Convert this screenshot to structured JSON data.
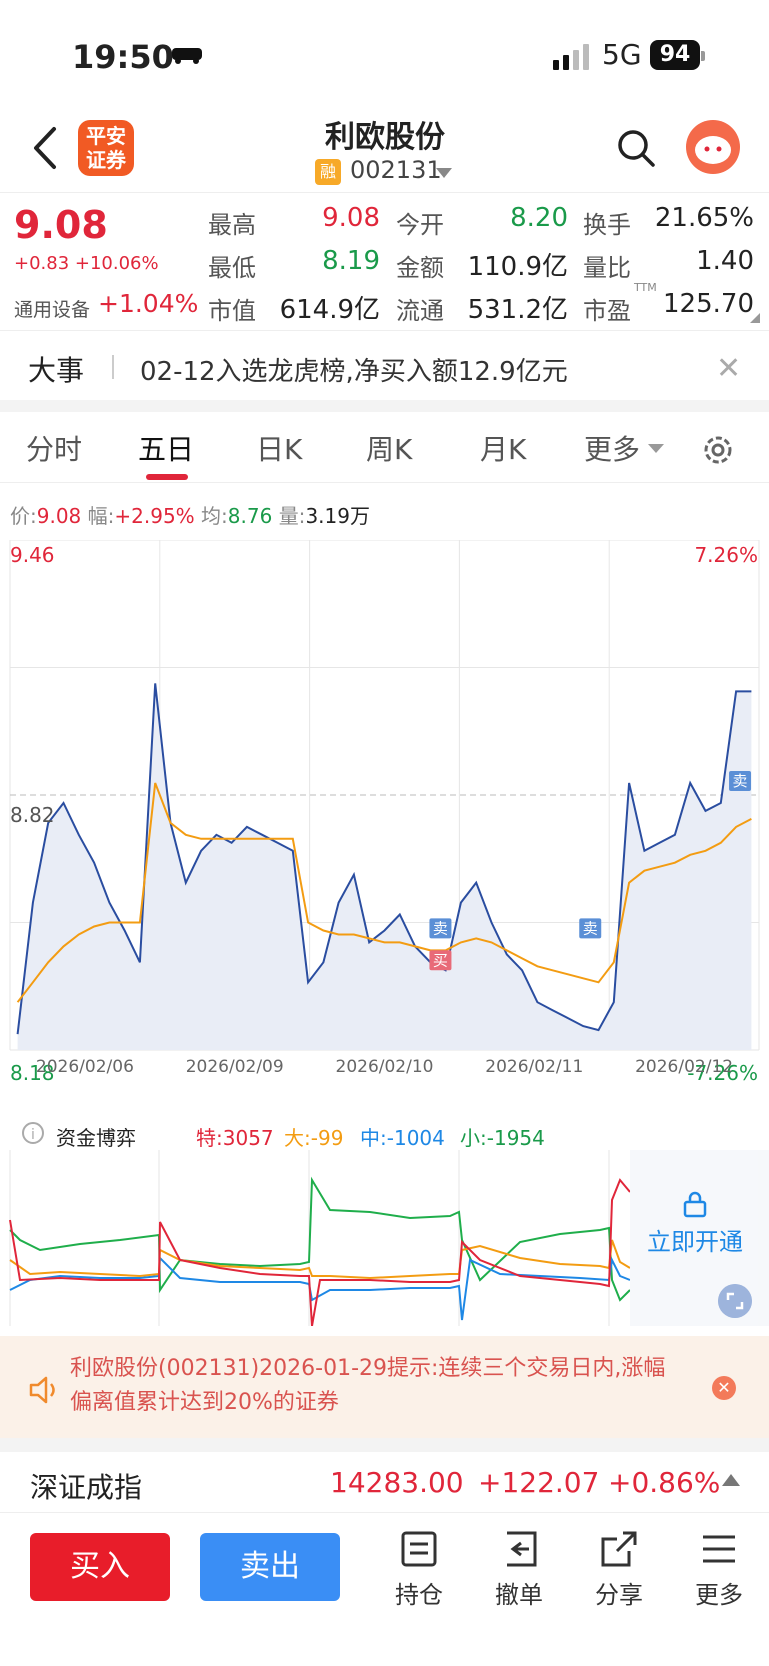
{
  "status": {
    "time": "19:50",
    "network": "5G",
    "battery": "94"
  },
  "header": {
    "logo_line1": "平安",
    "logo_line2": "证券",
    "stock_name": "利欧股份",
    "badge": "融",
    "stock_code": "002131"
  },
  "quote": {
    "price": "9.08",
    "change": "+0.83 +10.06%",
    "sector_name": "通用设备",
    "sector_pct": "+1.04%",
    "fields": [
      {
        "label": "最高",
        "value": "9.08",
        "color": "red"
      },
      {
        "label": "今开",
        "value": "8.20",
        "color": "green"
      },
      {
        "label": "换手",
        "value": "21.65%",
        "color": "black"
      },
      {
        "label": "最低",
        "value": "8.19",
        "color": "green"
      },
      {
        "label": "金额",
        "value": "110.9亿",
        "color": "black"
      },
      {
        "label": "量比",
        "value": "1.40",
        "color": "black"
      },
      {
        "label": "市值",
        "value": "614.9亿",
        "color": "black"
      },
      {
        "label": "流通",
        "value": "531.2亿",
        "color": "black"
      },
      {
        "label": "市盈",
        "value": "125.70",
        "color": "black"
      }
    ],
    "pe_suffix": "TTM"
  },
  "event": {
    "title": "大事",
    "text": "02-12入选龙虎榜,净买入额12.9亿元"
  },
  "tabs": [
    {
      "label": "分时",
      "active": false
    },
    {
      "label": "五日",
      "active": true
    },
    {
      "label": "日K",
      "active": false
    },
    {
      "label": "周K",
      "active": false
    },
    {
      "label": "月K",
      "active": false
    },
    {
      "label": "更多",
      "active": false
    }
  ],
  "info": {
    "price_label": "价:",
    "price": "9.08",
    "range_label": "幅:",
    "range": "+2.95%",
    "avg_label": "均:",
    "avg": "8.76",
    "vol_label": "量:",
    "vol": "3.19万"
  },
  "chart_data": {
    "type": "line",
    "title": "",
    "y_top_label": "9.46",
    "y_mid_label": "8.82",
    "y_bottom_label": "8.18",
    "pct_top_label": "7.26%",
    "pct_bottom_label": "-7.26%",
    "ylim": [
      8.18,
      9.46
    ],
    "prev_close": 8.82,
    "dates": [
      "2026/02/06",
      "2026/02/09",
      "2026/02/10",
      "2026/02/11",
      "2026/02/12"
    ],
    "series": [
      {
        "role": "price",
        "color": "#2a4da0",
        "values": [
          8.22,
          8.55,
          8.75,
          8.8,
          8.72,
          8.65,
          8.55,
          8.48,
          8.4,
          9.1,
          8.75,
          8.6,
          8.68,
          8.72,
          8.7,
          8.74,
          8.72,
          8.7,
          8.68,
          8.35,
          8.4,
          8.55,
          8.62,
          8.45,
          8.48,
          8.52,
          8.44,
          8.4,
          8.38,
          8.55,
          8.6,
          8.5,
          8.42,
          8.38,
          8.3,
          8.28,
          8.26,
          8.24,
          8.23,
          8.3,
          8.85,
          8.68,
          8.7,
          8.72,
          8.85,
          8.78,
          8.8,
          9.08,
          9.08
        ]
      },
      {
        "role": "average",
        "color": "#f39c12",
        "values": [
          8.3,
          8.35,
          8.4,
          8.44,
          8.47,
          8.49,
          8.5,
          8.5,
          8.5,
          8.85,
          8.75,
          8.72,
          8.71,
          8.71,
          8.71,
          8.71,
          8.71,
          8.71,
          8.71,
          8.5,
          8.48,
          8.47,
          8.47,
          8.46,
          8.45,
          8.45,
          8.44,
          8.43,
          8.43,
          8.45,
          8.46,
          8.45,
          8.43,
          8.41,
          8.39,
          8.38,
          8.37,
          8.36,
          8.35,
          8.4,
          8.6,
          8.63,
          8.64,
          8.65,
          8.67,
          8.68,
          8.7,
          8.74,
          8.76
        ]
      }
    ],
    "markers": [
      {
        "label": "卖",
        "kind": "sell",
        "day": 2,
        "y": 8.45
      },
      {
        "label": "买",
        "kind": "buy",
        "day": 2,
        "y": 8.37
      },
      {
        "label": "卖",
        "kind": "sell",
        "day": 3,
        "y": 8.45
      },
      {
        "label": "卖",
        "kind": "sell",
        "day": 4,
        "y": 8.82
      }
    ]
  },
  "fund": {
    "title": "资金博弈",
    "te_label": "特:",
    "te": "3057",
    "da_label": "大:",
    "da": "-99",
    "zhong_label": "中:",
    "zhong": "-1004",
    "xiao_label": "小:",
    "xiao": "-1954",
    "unlock_label": "立即开通"
  },
  "notice": {
    "text": "利欧股份(002131)2026-01-29提示:连续三个交易日内,涨幅偏离值累计达到20%的证券"
  },
  "index": {
    "name": "深证成指",
    "value": "14283.00",
    "change": "+122.07",
    "pct": "+0.86%"
  },
  "bottom": {
    "buy": "买入",
    "sell": "卖出",
    "nav": [
      {
        "label": "持仓",
        "icon": "position-icon"
      },
      {
        "label": "撤单",
        "icon": "cancel-order-icon"
      },
      {
        "label": "分享",
        "icon": "share-icon"
      },
      {
        "label": "更多",
        "icon": "menu-icon"
      }
    ]
  }
}
